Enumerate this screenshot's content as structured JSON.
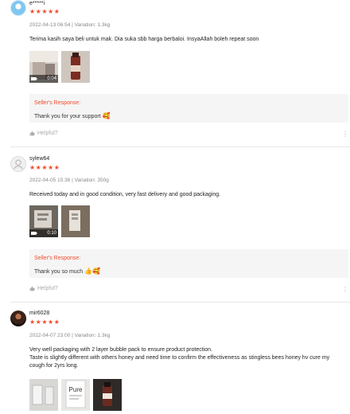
{
  "reviews": [
    {
      "username": "e*****i",
      "stars": "★★★★★",
      "meta": "2022-04-13 06:54 | Variation: 1.3kg",
      "text": "Terima kasih saya beli untuk mak. Dia suka sbb harga berbaloi. InsyaAllah boleh repeat soon",
      "media_badge_time": "0:04",
      "seller_response_title": "Seller's Response:",
      "seller_response_text": "Thank you for your support",
      "seller_response_emoji": "🥰",
      "helpful_label": "Helpful?"
    },
    {
      "username": "sylew64",
      "stars": "★★★★★",
      "meta": "2022-04-05 15:36 | Variation: 350g",
      "text": "Received today and in good condition, very fast delivery and good packaging.",
      "media_badge_time": "0:10",
      "seller_response_title": "Seller's Response:",
      "seller_response_text": "Thank you so much",
      "seller_response_emoji": "👍🥰",
      "helpful_label": "Helpful?"
    },
    {
      "username": "mir6028",
      "stars": "★★★★★",
      "meta": "2022-04-07 23:00 | Variation: 1.3kg",
      "text": "Very well packaging with 2 layer bubble pack to ensure product protection.\nTaste is slightly different with others honey and need time to confirm the effectiveness as stingless bees honey hv cure my cough for 2yrs long.",
      "thumb_label": "Pure"
    }
  ],
  "icons": {
    "thumb": "thumbs-up-icon",
    "more": "more-vertical-icon",
    "video": "video-camera-icon"
  },
  "colors": {
    "accent": "#ee4d2d",
    "muted": "#888888",
    "panel": "#f5f5f5"
  }
}
